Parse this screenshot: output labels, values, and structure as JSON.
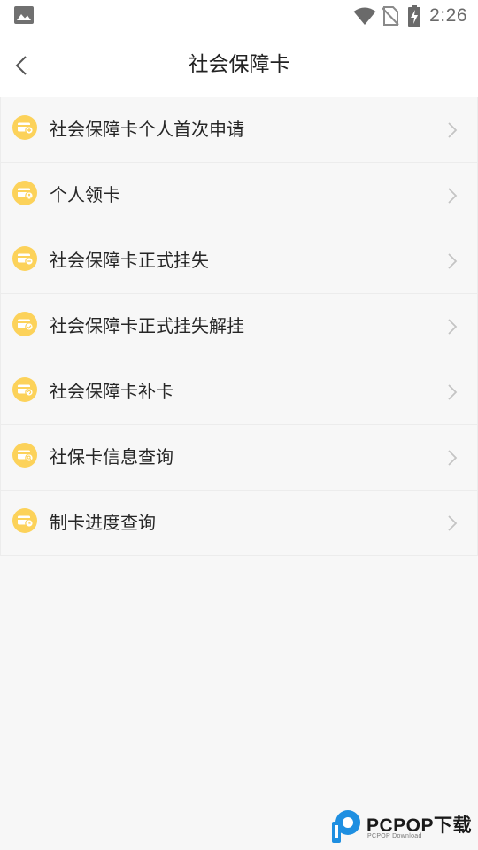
{
  "status_bar": {
    "time": "2:26"
  },
  "header": {
    "title": "社会保障卡"
  },
  "menu": {
    "items": [
      {
        "label": "社会保障卡个人首次申请",
        "icon": "card-add-icon"
      },
      {
        "label": "个人领卡",
        "icon": "card-person-icon"
      },
      {
        "label": "社会保障卡正式挂失",
        "icon": "card-report-loss-icon"
      },
      {
        "label": "社会保障卡正式挂失解挂",
        "icon": "card-unlock-icon"
      },
      {
        "label": "社会保障卡补卡",
        "icon": "card-replace-icon"
      },
      {
        "label": "社保卡信息查询",
        "icon": "card-info-icon"
      },
      {
        "label": "制卡进度查询",
        "icon": "card-progress-icon"
      }
    ]
  },
  "watermark": {
    "brand": "PCPOP下载",
    "subtitle": "PCPOP Download"
  },
  "colors": {
    "icon_badge": "#fcd25a",
    "background": "#f7f7f7",
    "divider": "#ececec",
    "chevron": "#c4c4c4",
    "logo_blue": "#1e8fe1"
  }
}
